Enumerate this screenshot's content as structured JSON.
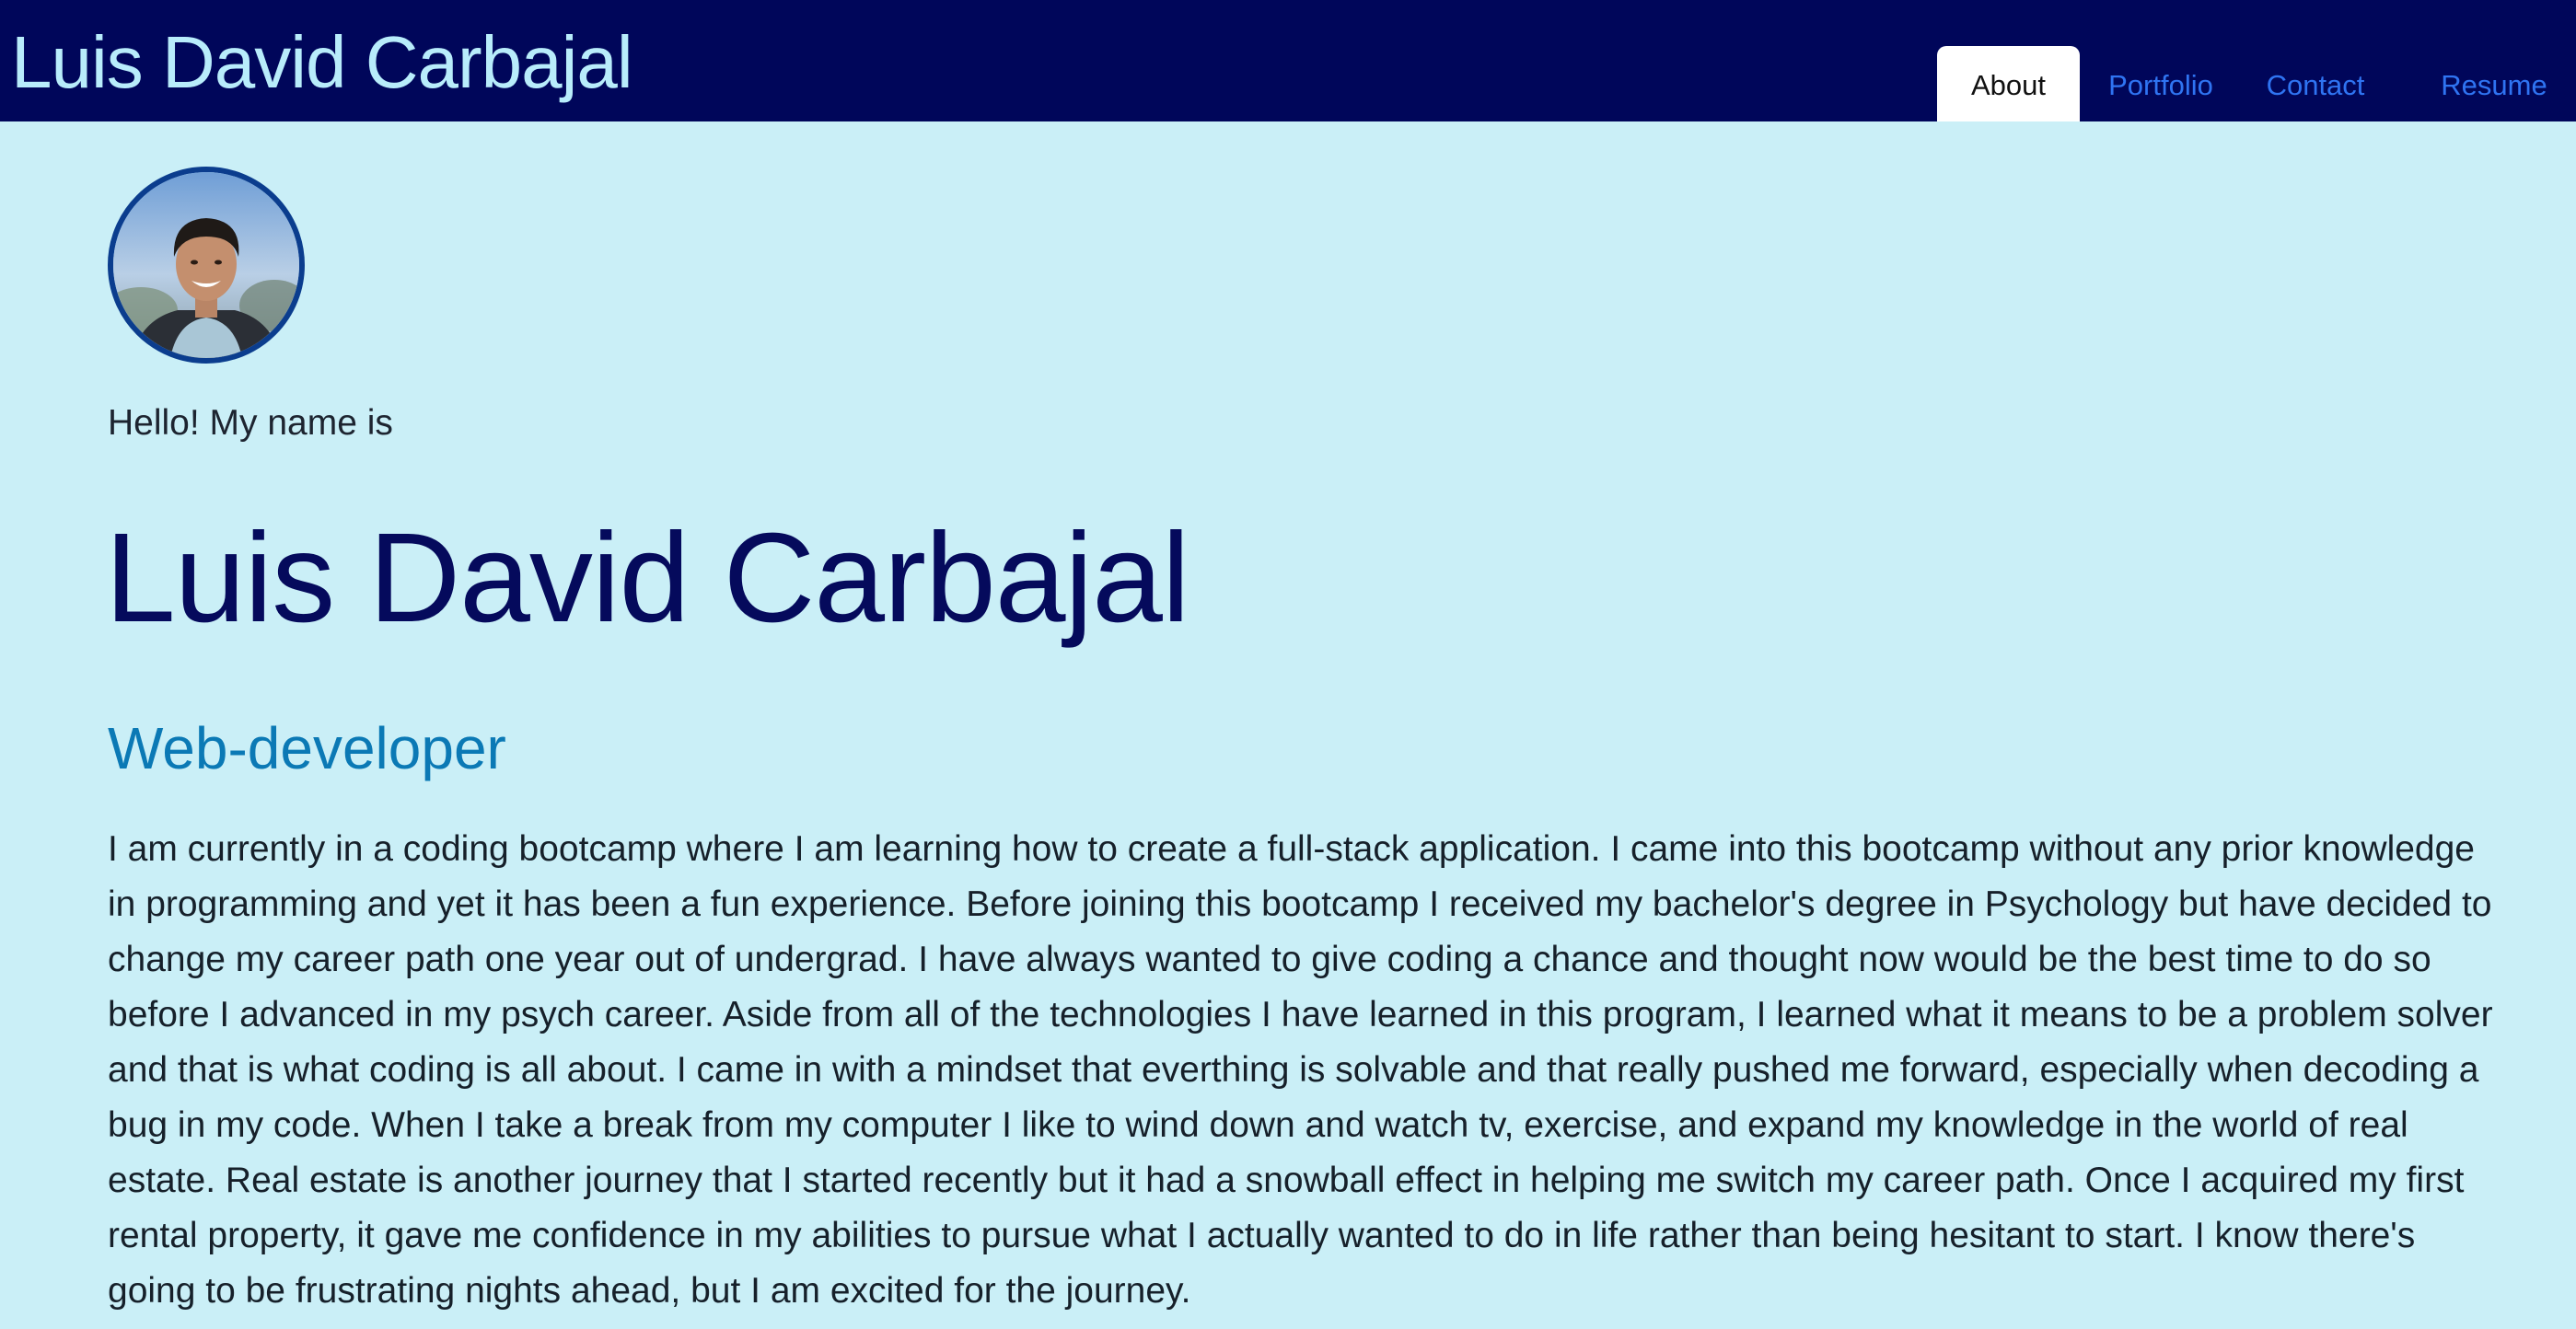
{
  "header": {
    "brand": "Luis David Carbajal",
    "nav": [
      {
        "label": "About",
        "active": true
      },
      {
        "label": "Portfolio",
        "active": false
      },
      {
        "label": "Contact",
        "active": false
      },
      {
        "label": "Resume",
        "active": false
      }
    ]
  },
  "about": {
    "greeting": "Hello! My name is",
    "name": "Luis David Carbajal",
    "role": "Web-developer",
    "bio": "I am currently in a coding bootcamp where I am learning how to create a full-stack application. I came into this bootcamp without any prior knowledge in programming and yet it has been a fun experience. Before joining this bootcamp I received my bachelor's degree in Psychology but have decided to change my career path one year out of undergrad. I have always wanted to give coding a chance and thought now would be the best time to do so before I advanced in my psych career. Aside from all of the technologies I have learned in this program, I learned what it means to be a problem solver and that is what coding is all about. I came in with a mindset that everthing is solvable and that really pushed me forward, especially when decoding a bug in my code. When I take a break from my computer I like to wind down and watch tv, exercise, and expand my knowledge in the world of real estate. Real estate is another journey that I started recently but it had a snowball effect in helping me switch my career path. Once I acquired my first rental property, it gave me confidence in my abilities to pursue what I actually wanted to do in life rather than being hesitant to start. I know there's going to be frustrating nights ahead, but I am excited for the journey."
  },
  "colors": {
    "navbar_bg": "#00065a",
    "page_bg": "#caeff7",
    "brand_text": "#b8ecfb",
    "nav_link": "#2f74f2",
    "hero_name": "#050a5c",
    "role": "#0b79b5",
    "avatar_border": "#0b3d8e"
  }
}
